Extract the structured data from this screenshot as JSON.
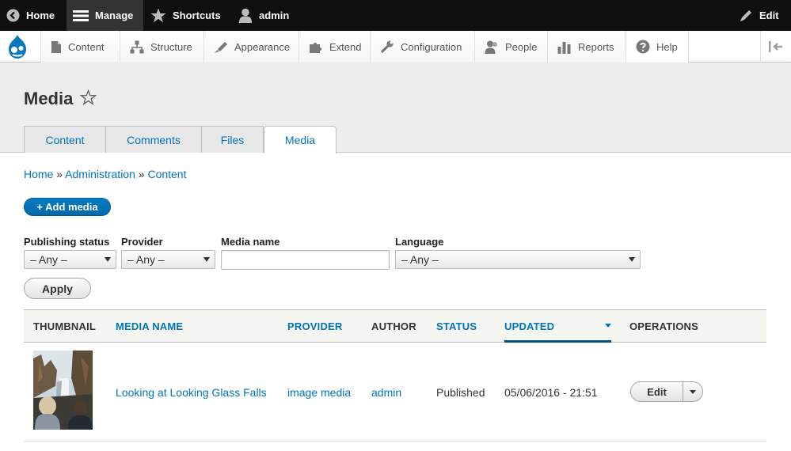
{
  "toolbar": {
    "home": "Home",
    "manage": "Manage",
    "shortcuts": "Shortcuts",
    "user": "admin",
    "edit": "Edit"
  },
  "tray": {
    "items": [
      "Content",
      "Structure",
      "Appearance",
      "Extend",
      "Configuration",
      "People",
      "Reports",
      "Help"
    ]
  },
  "page": {
    "title": "Media"
  },
  "tabs": [
    "Content",
    "Comments",
    "Files",
    "Media"
  ],
  "active_tab": "Media",
  "breadcrumb": {
    "items": [
      "Home",
      "Administration",
      "Content"
    ],
    "separator": "»"
  },
  "add_media": "+ Add media",
  "filters": {
    "publishing_status": {
      "label": "Publishing status",
      "value": "– Any –"
    },
    "provider": {
      "label": "Provider",
      "value": "– Any –"
    },
    "media_name": {
      "label": "Media name",
      "value": ""
    },
    "language": {
      "label": "Language",
      "value": "– Any –"
    },
    "apply": "Apply"
  },
  "table": {
    "headers": [
      "THUMBNAIL",
      "MEDIA NAME",
      "PROVIDER",
      "AUTHOR",
      "STATUS",
      "UPDATED",
      "OPERATIONS"
    ],
    "rows": [
      {
        "media_name": "Looking at Looking Glass Falls",
        "provider": "image media",
        "author": "admin",
        "status": "Published",
        "updated": "05/06/2016 - 21:51",
        "operation": "Edit"
      }
    ]
  },
  "colors": {
    "link": "#0074bd",
    "toolbar_bg": "#0f0f0f",
    "primary_button": "#0074bd"
  },
  "icons": [
    "back-icon",
    "menu-icon",
    "star-icon",
    "user-icon",
    "pencil-icon",
    "drupal-logo",
    "content-icon",
    "structure-icon",
    "appearance-icon",
    "extend-icon",
    "configuration-icon",
    "people-icon",
    "reports-icon",
    "help-icon",
    "collapse-icon",
    "shortcut-star-icon"
  ]
}
